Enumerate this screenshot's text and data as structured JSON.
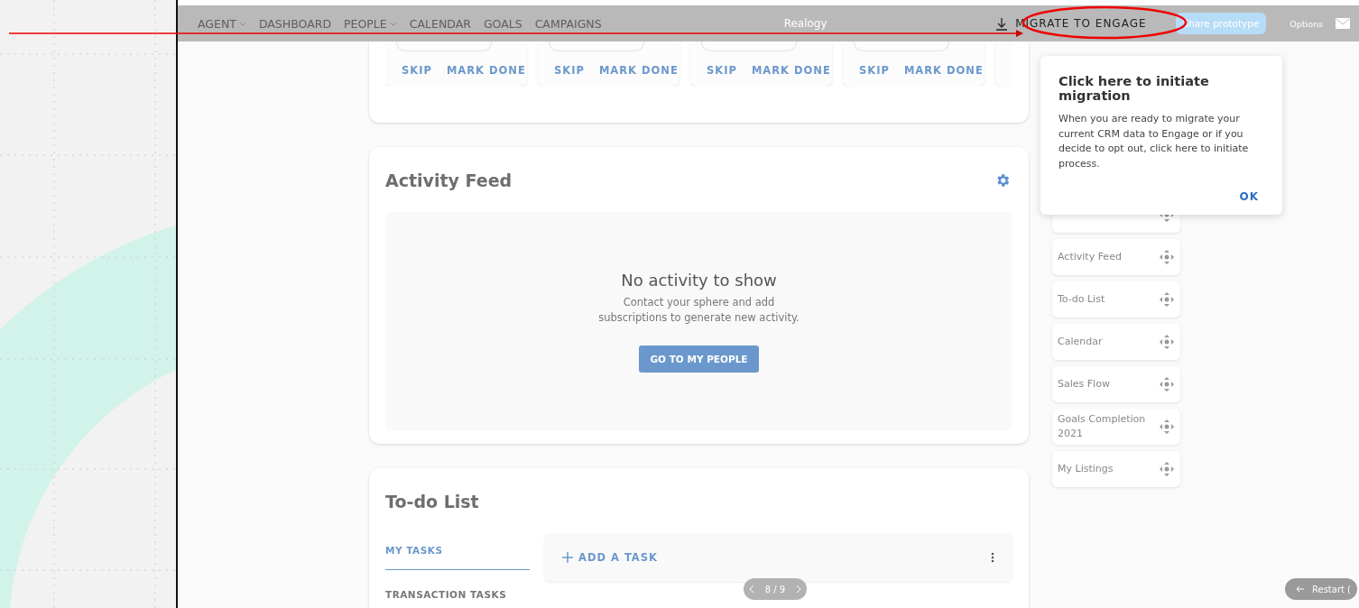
{
  "topbar": {
    "nav": [
      {
        "label": "AGENT",
        "has_menu": true
      },
      {
        "label": "DASHBOARD",
        "has_menu": false
      },
      {
        "label": "PEOPLE",
        "has_menu": true
      },
      {
        "label": "CALENDAR",
        "has_menu": false
      },
      {
        "label": "GOALS",
        "has_menu": false
      },
      {
        "label": "CAMPAIGNS",
        "has_menu": false
      }
    ],
    "brand": "Realogy",
    "migrate_button": "MIGRATE TO ENGAGE",
    "share_button": "Share prototype",
    "options": "Options"
  },
  "task_cards": [
    {
      "actions": [
        "SKIP",
        "MARK DONE"
      ]
    },
    {
      "actions": [
        "SKIP",
        "MARK DONE"
      ]
    },
    {
      "actions": [
        "SKIP",
        "MARK DONE"
      ]
    },
    {
      "actions": [
        "SKIP",
        "MARK DONE"
      ]
    }
  ],
  "activity_feed": {
    "title": "Activity Feed",
    "empty_title": "No activity to show",
    "empty_text": "Contact your sphere and add subscriptions to generate new activity.",
    "button": "GO TO MY PEOPLE"
  },
  "todo": {
    "title": "To-do List",
    "tabs": [
      {
        "label": "MY TASKS",
        "selected": true
      },
      {
        "label": "TRANSACTION TASKS",
        "selected": false
      }
    ],
    "add_task": "ADD A TASK"
  },
  "widgets": [
    "Activity Feed",
    "To-do List",
    "Calendar",
    "Sales Flow",
    "Goals Completion 2021",
    "My Listings"
  ],
  "popover": {
    "title": "Click here to initiate migration",
    "text": "When you are ready to migrate your current CRM data to Engage or if you decide to opt out, click here to initiate process.",
    "button": "OK"
  },
  "pager": "8 / 9",
  "restart": "Restart ("
}
